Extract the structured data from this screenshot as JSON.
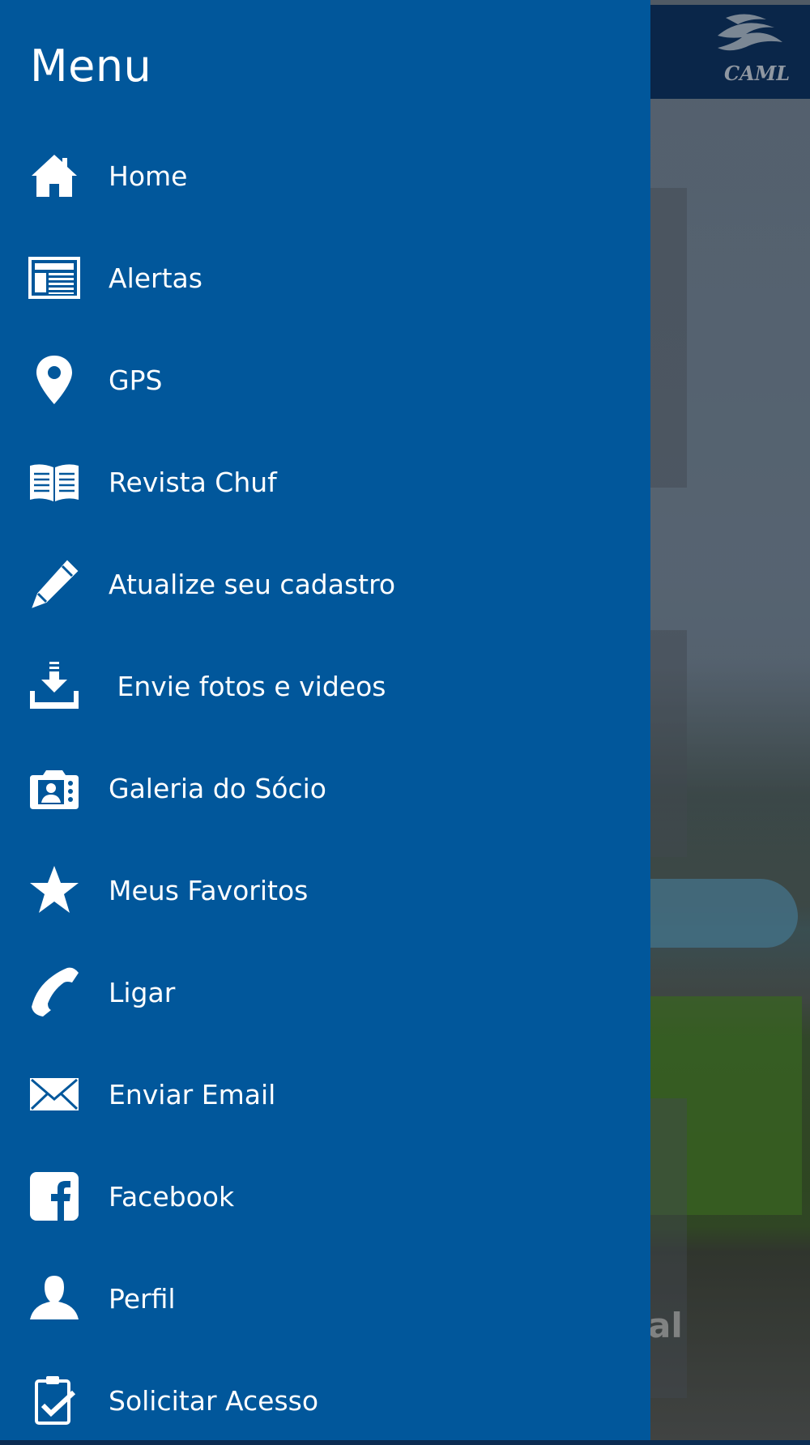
{
  "drawer": {
    "title": "Menu",
    "items": [
      {
        "label": "Home",
        "icon": "home-icon"
      },
      {
        "label": "Alertas",
        "icon": "news-icon"
      },
      {
        "label": "GPS",
        "icon": "map-pin-icon"
      },
      {
        "label": "Revista Chuf",
        "icon": "book-icon"
      },
      {
        "label": "Atualize seu cadastro",
        "icon": "pencil-icon"
      },
      {
        "label": " Envie fotos e videos",
        "icon": "download-icon"
      },
      {
        "label": "Galeria do Sócio",
        "icon": "camera-icon"
      },
      {
        "label": "Meus Favoritos",
        "icon": "star-icon"
      },
      {
        "label": "Ligar",
        "icon": "phone-icon"
      },
      {
        "label": "Enviar Email",
        "icon": "mail-icon"
      },
      {
        "label": "Facebook",
        "icon": "facebook-icon"
      },
      {
        "label": "Perfil",
        "icon": "user-icon"
      },
      {
        "label": "Solicitar Acesso",
        "icon": "clipboard-check-icon"
      }
    ]
  },
  "background": {
    "logo_text": "CAML",
    "card_text_fragment": "al"
  },
  "colors": {
    "drawer_bg": "#01579b",
    "topbar_bg": "#0e3566",
    "text": "#ffffff"
  }
}
